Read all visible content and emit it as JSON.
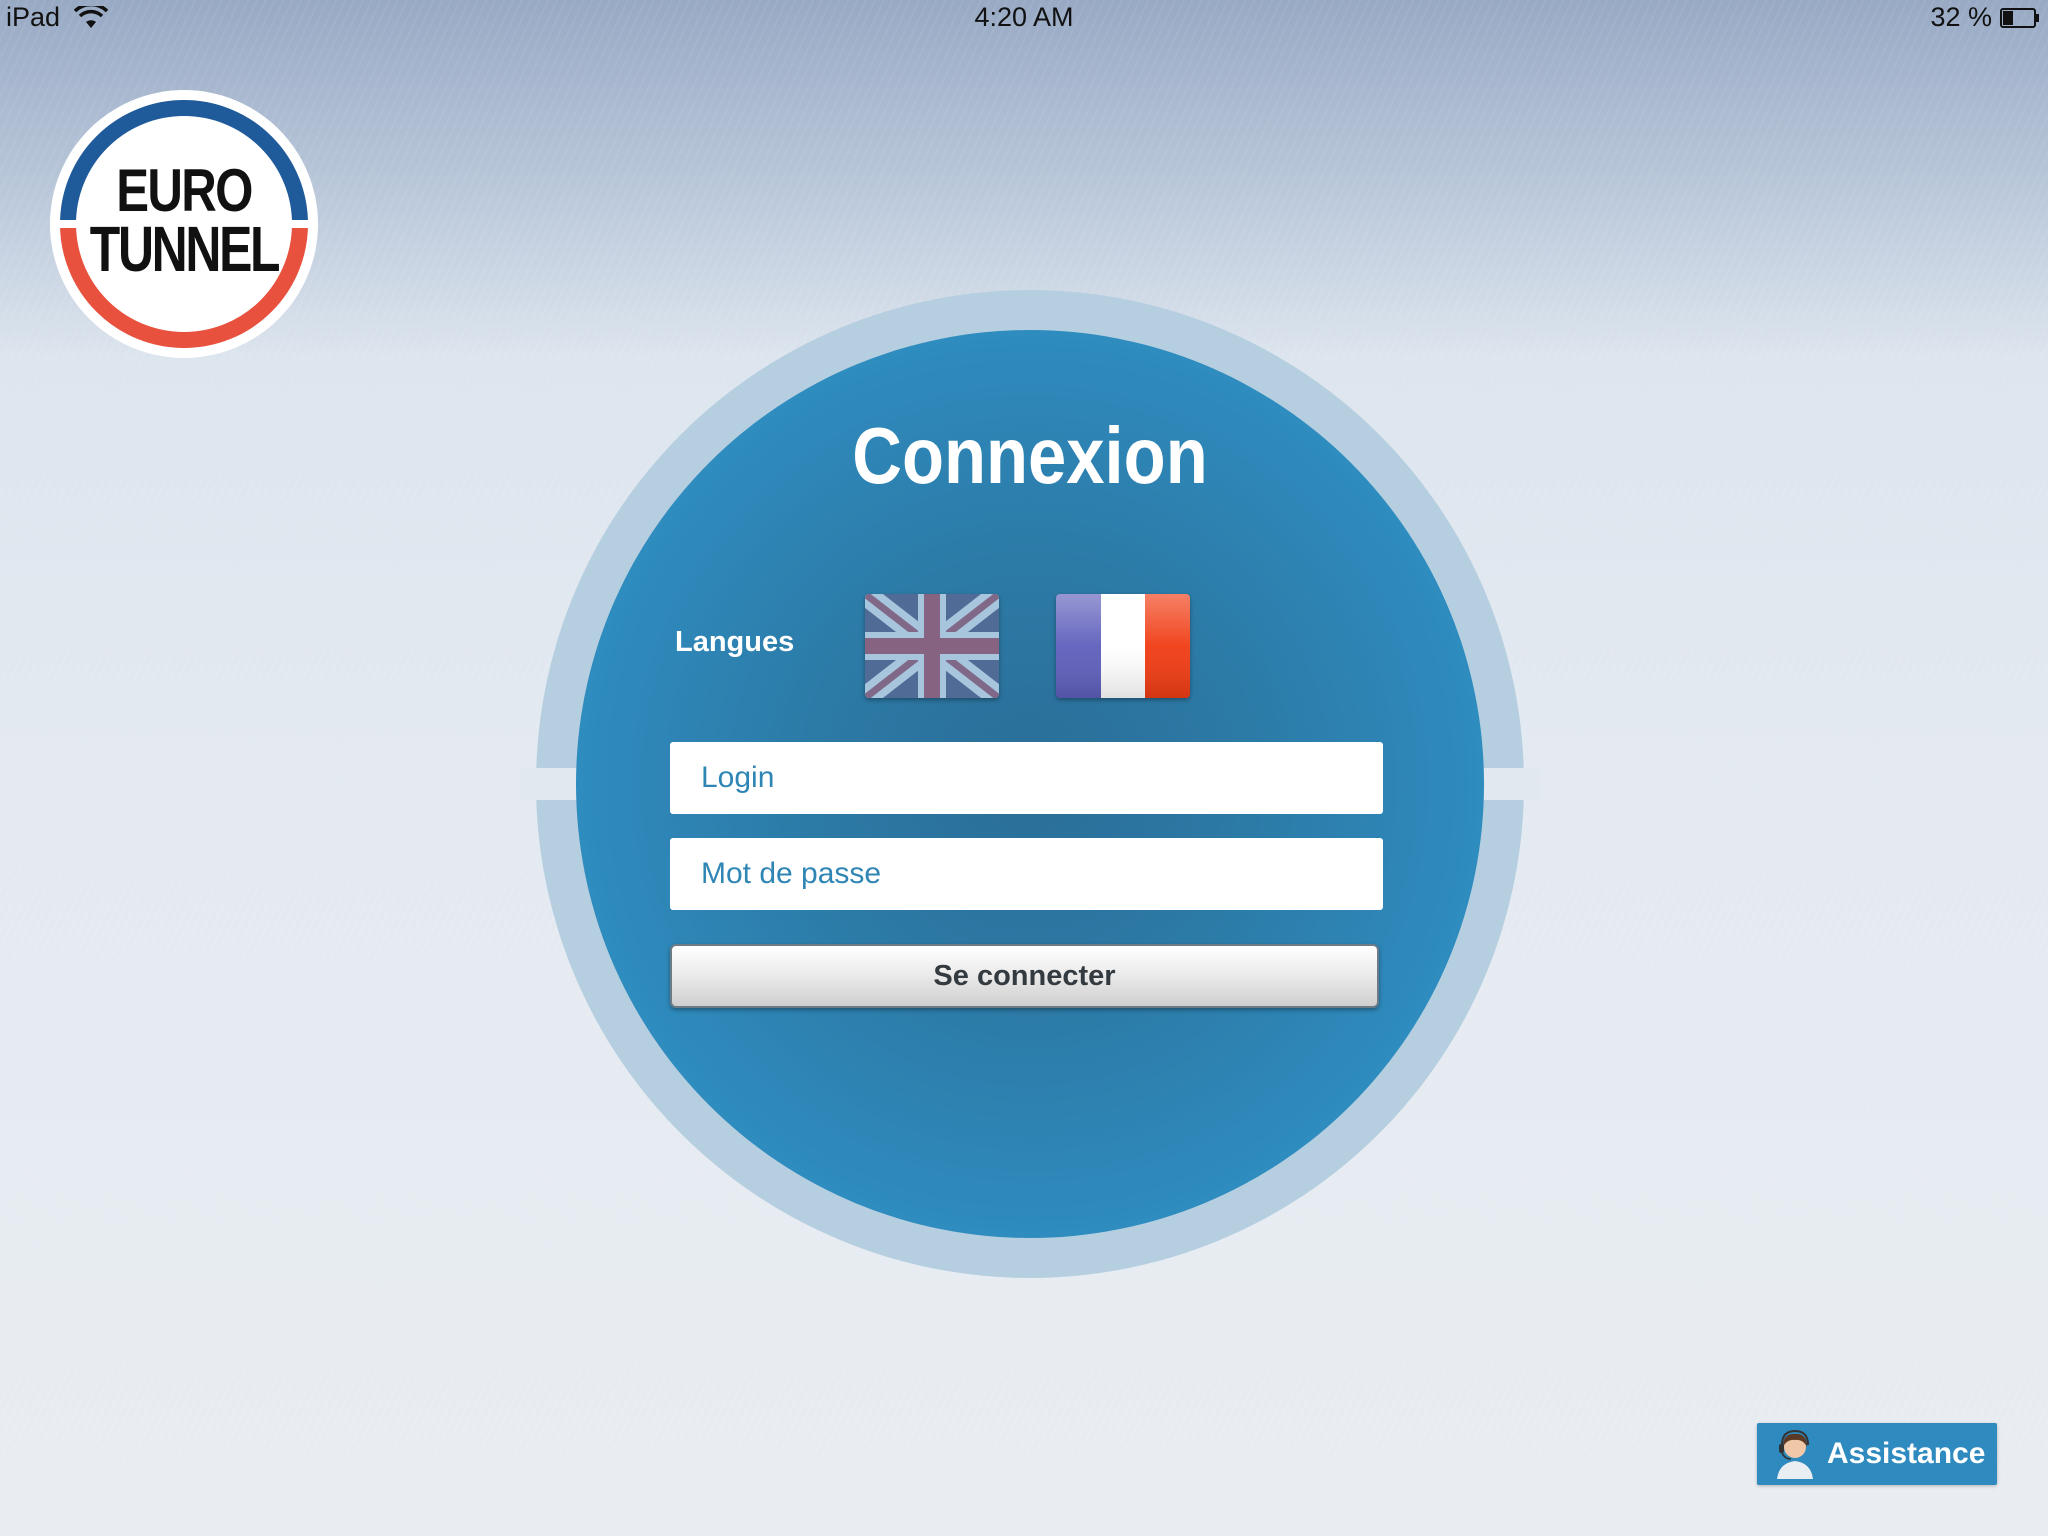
{
  "status_bar": {
    "device": "iPad",
    "time": "4:20 AM",
    "battery": "32 %"
  },
  "logo": {
    "line1": "EURO",
    "line2": "TUNNEL"
  },
  "login": {
    "title": "Connexion",
    "languages_label": "Langues",
    "login_placeholder": "Login",
    "password_placeholder": "Mot de passe",
    "submit_label": "Se connecter"
  },
  "assistance": {
    "label": "Assistance"
  },
  "colors": {
    "circle_blue": "#2f8cbe",
    "ring_blue": "#b5cfe1",
    "logo_blue": "#1f5a9a",
    "logo_red": "#e8513e"
  }
}
